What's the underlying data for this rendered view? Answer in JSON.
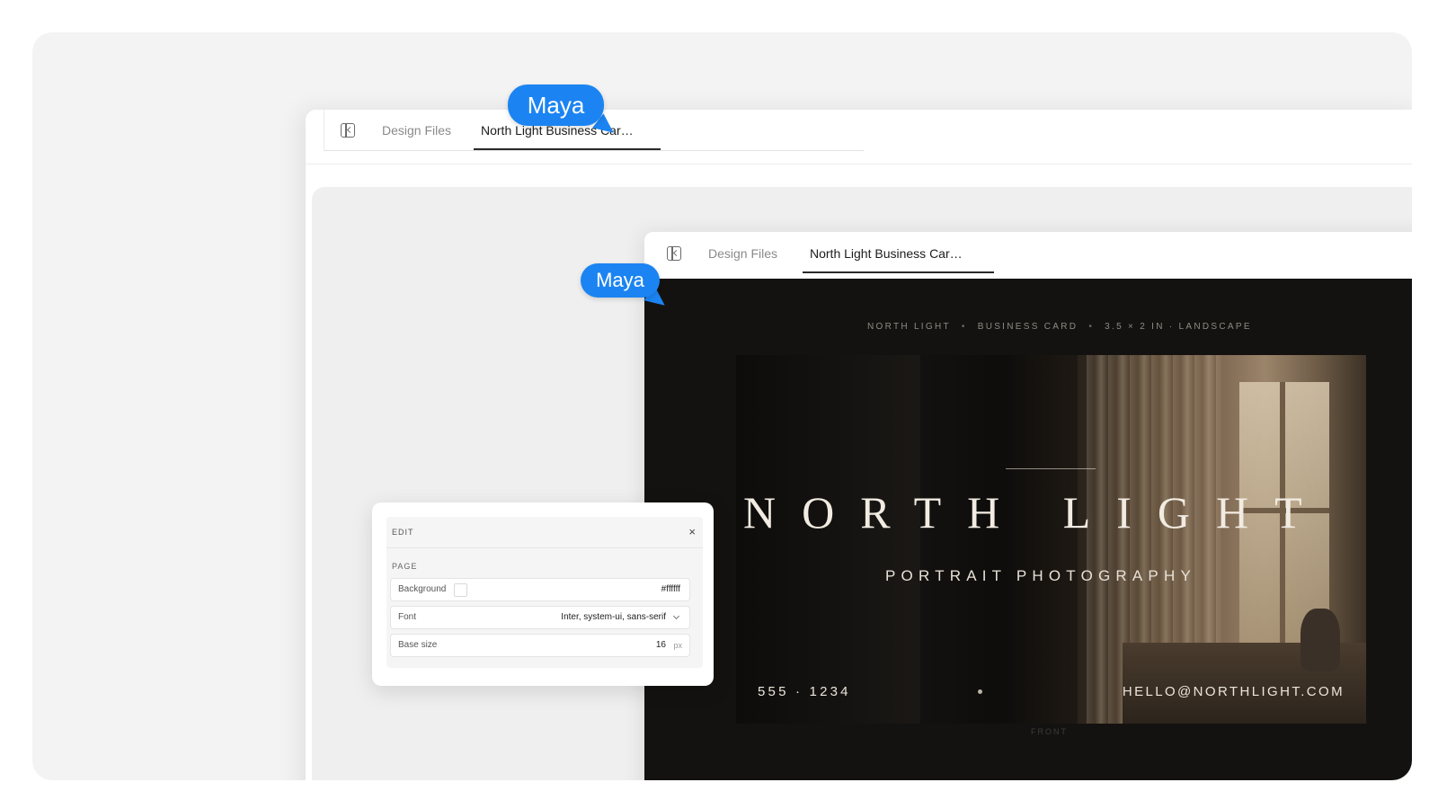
{
  "outer_window": {
    "tabs": [
      {
        "label": "Design Files",
        "active": false
      },
      {
        "label": "North Light Business Car…",
        "active": true
      }
    ]
  },
  "inner_window": {
    "tabs": [
      {
        "label": "Design Files",
        "active": false
      },
      {
        "label": "North Light Business Car…",
        "active": true
      }
    ]
  },
  "cursors": [
    {
      "user": "Maya",
      "color": "#1b84f2"
    },
    {
      "user": "Maya",
      "color": "#1b84f2"
    }
  ],
  "card_preview": {
    "meta": [
      "NORTH LIGHT",
      "BUSINESS CARD",
      "3.5 × 2 IN · LANDSCAPE"
    ],
    "title": "NORTH LIGHT",
    "subtitle": "PORTRAIT PHOTOGRAPHY",
    "phone": "555 · 1234",
    "email": "HELLO@NORTHLIGHT.COM",
    "side_label": "FRONT"
  },
  "edit_panel": {
    "title": "EDIT",
    "close_glyph": "×",
    "section": "PAGE",
    "fields": {
      "background": {
        "label": "Background",
        "value": "#ffffff"
      },
      "font": {
        "label": "Font",
        "value": "Inter, system-ui, sans-serif"
      },
      "base_size": {
        "label": "Base size",
        "value": "16",
        "unit": "px"
      }
    }
  }
}
